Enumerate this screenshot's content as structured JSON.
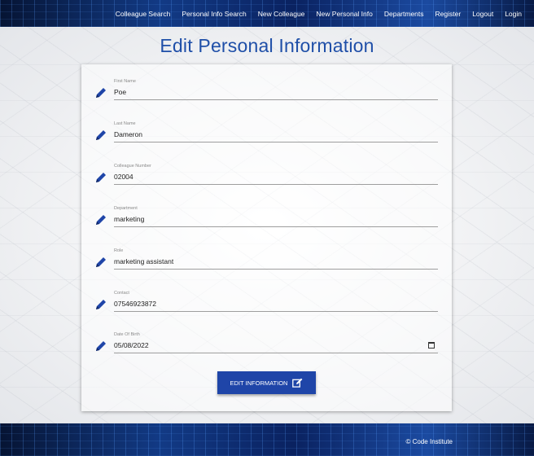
{
  "nav": {
    "links": [
      "Colleague Search",
      "Personal Info Search",
      "New Colleague",
      "New Personal Info",
      "Departments",
      "Register",
      "Logout",
      "Login"
    ]
  },
  "page": {
    "title": "Edit Personal Information"
  },
  "form": {
    "fields": [
      {
        "label": "First Name",
        "value": "Poe"
      },
      {
        "label": "Last Name",
        "value": "Dameron"
      },
      {
        "label": "Colleague Number",
        "value": "02004"
      },
      {
        "label": "Department",
        "value": "marketing"
      },
      {
        "label": "Role",
        "value": "marketing assistant"
      },
      {
        "label": "Contact",
        "value": "07546923872"
      },
      {
        "label": "Date Of Birth",
        "value": "05/08/2022"
      }
    ],
    "submit_label": "EDIT INFORMATION"
  },
  "footer": {
    "copyright": "© Code Institute"
  },
  "colors": {
    "accent": "#1f45a8",
    "title": "#1f4fa8",
    "header_bg": "#0b1f4a"
  }
}
